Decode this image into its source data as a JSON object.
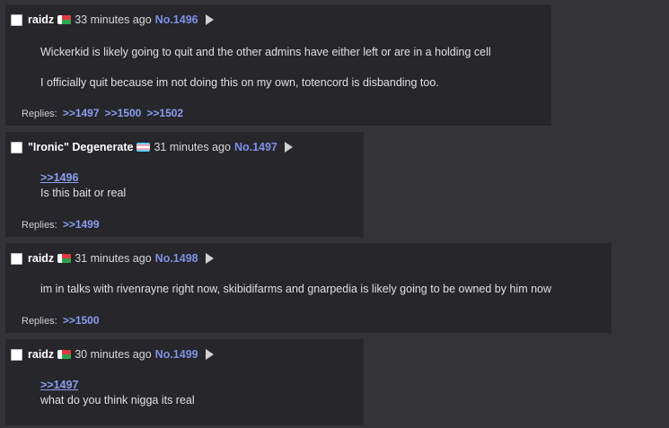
{
  "posts": [
    {
      "name": "raidz",
      "flag": "madagascar-flag",
      "time": "33 minutes ago",
      "number": "No.1496",
      "quote": "",
      "lines": [
        "Wickerkid is likely going to quit and the other admins have either left or are in a  holding cell",
        "I officially quit because im not doing this on my own, totencord is disbanding too."
      ],
      "replies_label": "Replies:",
      "replies": [
        ">>1497",
        ">>1500",
        ">>1502"
      ]
    },
    {
      "name": "\"Ironic\" Degenerate",
      "flag": "pride-flag",
      "time": "31 minutes ago",
      "number": "No.1497",
      "quote": ">>1496",
      "lines": [
        "Is this bait or real"
      ],
      "replies_label": "Replies:",
      "replies": [
        ">>1499"
      ]
    },
    {
      "name": "raidz",
      "flag": "madagascar-flag",
      "time": "31 minutes ago",
      "number": "No.1498",
      "quote": "",
      "lines": [
        "im in talks with rivenrayne right now, skibidifarms and gnarpedia is likely going to be owned by him now"
      ],
      "replies_label": "Replies:",
      "replies": [
        ">>1500"
      ]
    },
    {
      "name": "raidz",
      "flag": "madagascar-flag",
      "time": "30 minutes ago",
      "number": "No.1499",
      "quote": ">>1497",
      "lines": [
        "what do you think nigga its real"
      ],
      "replies_label": "",
      "replies": []
    }
  ],
  "colors": {
    "page_bg": "#333338",
    "post_bg": "#26262b",
    "link": "#7f90e6"
  }
}
